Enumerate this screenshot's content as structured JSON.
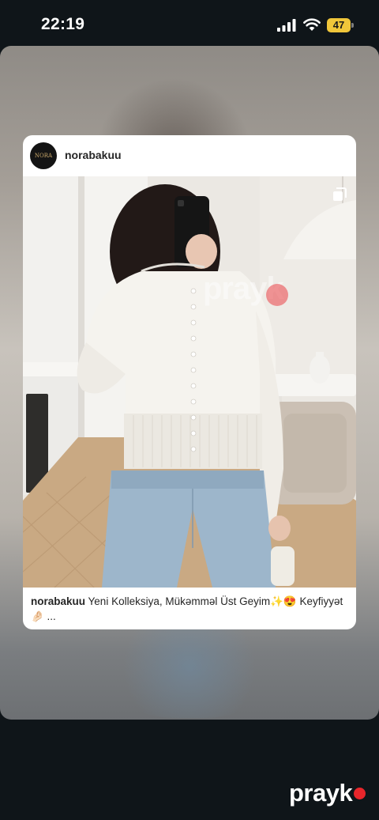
{
  "status_bar": {
    "time": "22:19",
    "battery": "47",
    "icons": [
      "cellular-signal-icon",
      "wifi-icon",
      "battery-icon"
    ]
  },
  "post": {
    "username": "norabakuu",
    "avatar_text": "NORA",
    "caption_user": "norabakuu",
    "caption_text": "Yeni Kolleksiya, Mükəmməl Üst Geyim✨😍 Keyfiyyət🤌🏻 ...",
    "multi_image_icon": "carousel-icon"
  },
  "watermark": {
    "text": "prayk"
  },
  "brand": {
    "text": "prayk",
    "dot_color": "#e8262b"
  },
  "colors": {
    "battery": "#f0c63a",
    "background": "#0f1519"
  }
}
